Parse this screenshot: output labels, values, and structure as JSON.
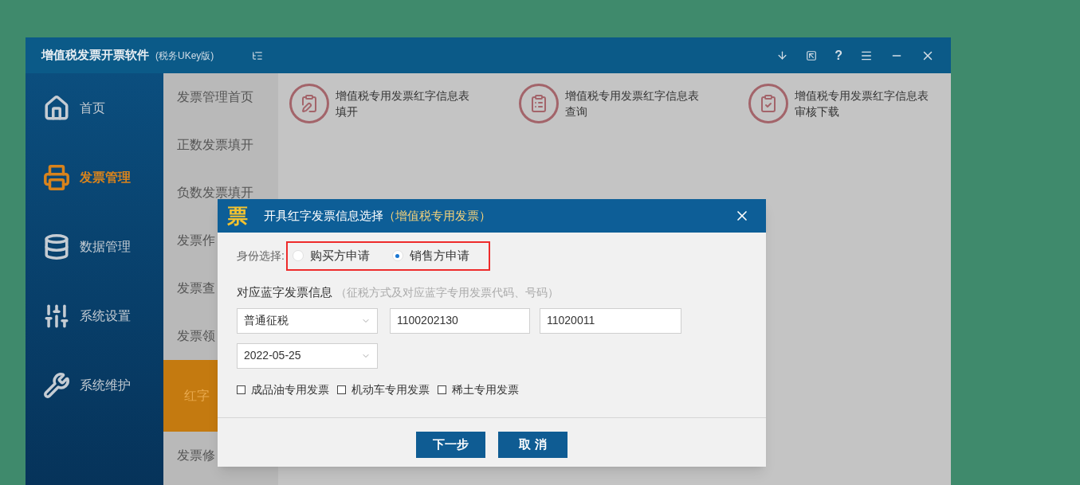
{
  "app": {
    "title": "增值税发票开票软件",
    "edition": "(税务UKey版)",
    "help": "?"
  },
  "nav": [
    {
      "label": "首页",
      "kind": "home",
      "selected": false
    },
    {
      "label": "发票管理",
      "kind": "invoice",
      "selected": true
    },
    {
      "label": "数据管理",
      "kind": "data",
      "selected": false
    },
    {
      "label": "系统设置",
      "kind": "settings",
      "selected": false
    },
    {
      "label": "系统维护",
      "kind": "tools",
      "selected": false
    }
  ],
  "submenu": [
    {
      "label": "发票管理首页",
      "selected": false
    },
    {
      "label": "正数发票填开",
      "selected": false
    },
    {
      "label": "负数发票填开",
      "selected": false
    },
    {
      "label": "发票作",
      "selected": false
    },
    {
      "label": "发票查",
      "selected": false
    },
    {
      "label": "发票领",
      "selected": false
    },
    {
      "label": "红字",
      "selected": true
    },
    {
      "label": "发票修",
      "selected": false
    }
  ],
  "tiles": [
    {
      "kind": "fill",
      "label": "增值税专用发票红字信息表",
      "sub": "填开"
    },
    {
      "kind": "query",
      "label": "增值税专用发票红字信息表",
      "sub": "查询"
    },
    {
      "kind": "download",
      "label": "增值税专用发票红字信息表",
      "sub": "审核下载"
    }
  ],
  "dialog": {
    "logo": "票",
    "title": "开具红字发票信息选择",
    "title_note": "（增值税专用发票）",
    "identity_label": "身份选择:",
    "identity_options": [
      {
        "label": "购买方申请",
        "selected": false
      },
      {
        "label": "销售方申请",
        "selected": true
      }
    ],
    "section_label": "对应蓝字发票信息",
    "section_hint": "（征税方式及对应蓝字专用发票代码、号码）",
    "tax_method": {
      "value": "普通征税"
    },
    "invoice_code": {
      "value": "1100202130"
    },
    "invoice_number": {
      "value": "11020011"
    },
    "date": {
      "value": "2022-05-25"
    },
    "options": [
      {
        "label": "成品油专用发票",
        "checked": false
      },
      {
        "label": "机动车专用发票",
        "checked": false
      },
      {
        "label": "稀土专用发票",
        "checked": false
      }
    ],
    "buttons": [
      {
        "label": "下一步"
      },
      {
        "label": "取 消"
      }
    ]
  }
}
